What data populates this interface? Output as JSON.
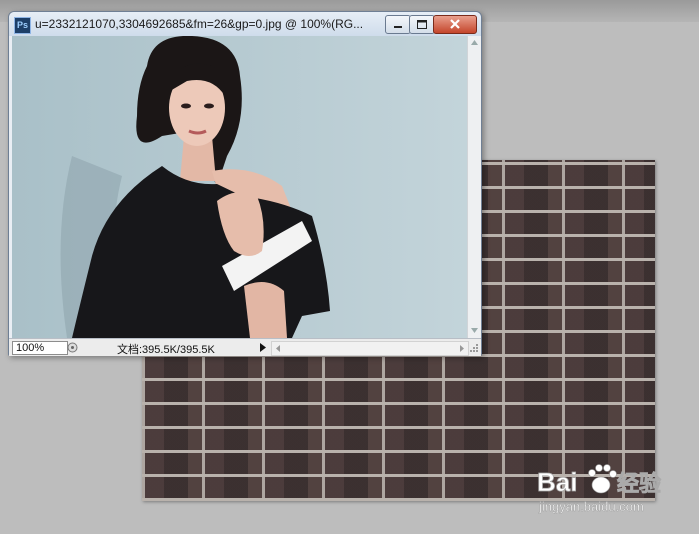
{
  "app": {
    "logo_text": "Ps"
  },
  "document_window": {
    "title": "u=2332121070,3304692685&fm=26&gp=0.jpg @ 100%(RG..."
  },
  "statusbar": {
    "zoom": "100%",
    "doc_info": "文档:395.5K/395.5K"
  },
  "watermark": {
    "brand": "Bai",
    "brand_cn": "经验",
    "url": "jingyan.baidu.com"
  },
  "colors": {
    "workspace_bg": "#bdbdbd",
    "photo_bg": "#b9cdd4",
    "close_button": "#c4452b"
  },
  "icons": [
    "ps-logo-icon",
    "minimize-icon",
    "maximize-icon",
    "close-icon",
    "status-menu-arrow-icon",
    "scroll-up-icon",
    "scroll-down-icon",
    "resize-grip-icon",
    "paw-icon"
  ]
}
